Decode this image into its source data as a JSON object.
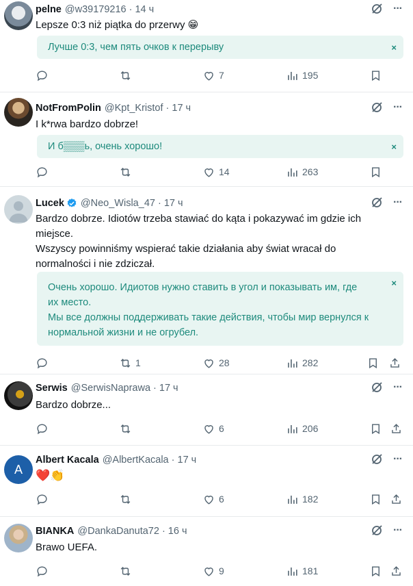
{
  "tweets": [
    {
      "name": "pelne",
      "handle": "@w39179216 · 14 ч",
      "text": "Lepsze 0:3 niż piątka do przerwy 😁",
      "translation": "Лучше 0:3, чем пять очков к перерыву",
      "replies": "",
      "retweets": "",
      "likes": "7",
      "views": "195",
      "verified": false
    },
    {
      "name": "NotFromPolin",
      "handle": "@Kpt_Kristof · 17 ч",
      "text": "I k*rwa bardzo dobrze!",
      "translation": "И б▒▒▒ь, очень хорошо!",
      "replies": "",
      "retweets": "",
      "likes": "14",
      "views": "263",
      "verified": false
    },
    {
      "name": "Lucek",
      "handle": "@Neo_Wisla_47 · 17 ч",
      "text_lines": [
        "Bardzo dobrze. Idiotów trzeba stawiać do kąta i pokazywać im gdzie ich",
        "miejsce.",
        "Wszyscy powinniśmy wspierać takie działania aby świat wracał do",
        "normalności i nie zdziczał."
      ],
      "translation_lines": [
        "Очень хорошо. Идиотов нужно ставить в угол и показывать им, где",
        "их место.",
        "Мы все должны поддерживать такие действия, чтобы мир вернулся к",
        "нормальной жизни и не огрубел."
      ],
      "replies": "",
      "retweets": "1",
      "likes": "28",
      "views": "282",
      "verified": true
    },
    {
      "name": "Serwis",
      "handle": "@SerwisNaprawa · 17 ч",
      "text": "Bardzo dobrze...",
      "replies": "",
      "retweets": "",
      "likes": "6",
      "views": "206",
      "verified": false
    },
    {
      "name": "Albert Kacala",
      "handle": "@AlbertKacala · 17 ч",
      "avatar_letter": "A",
      "text": "❤️👏",
      "replies": "",
      "retweets": "",
      "likes": "6",
      "views": "182",
      "verified": false
    },
    {
      "name": "BIANKA",
      "handle": "@DankaDanuta72 · 16 ч",
      "text": "Brawo UEFA.",
      "replies": "",
      "retweets": "",
      "likes": "9",
      "views": "181",
      "verified": false
    }
  ],
  "close_symbol": "×",
  "more_symbol": "···",
  "colors": {
    "accent": "#1d9bf0",
    "translation_bg": "#e8f5f2",
    "translation_text": "#1d8a7c",
    "muted": "#536471"
  }
}
